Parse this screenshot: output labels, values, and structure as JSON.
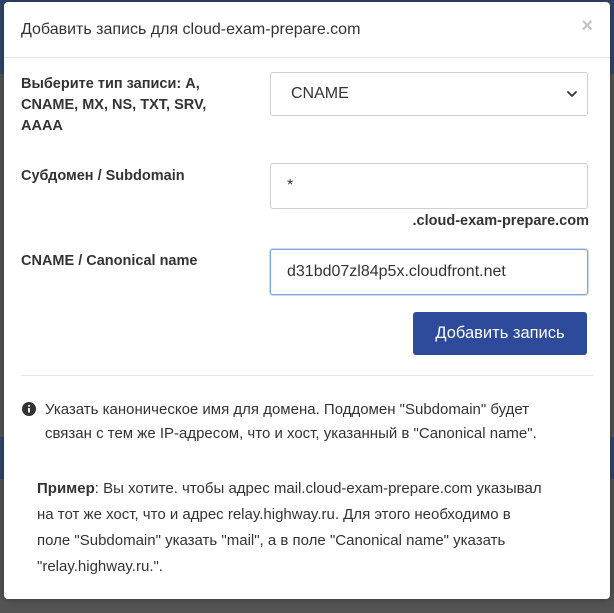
{
  "modal": {
    "title": "Добавить запись для cloud-exam-prepare.com",
    "close_label": "×"
  },
  "form": {
    "record_type": {
      "label_line1": "Выберите тип записи: A,",
      "label_line2": "CNAME, MX, NS, TXT, SRV,",
      "label_line3": "AAAA",
      "selected": "CNAME"
    },
    "subdomain": {
      "label": "Субдомен / Subdomain",
      "value": "*",
      "suffix": ".cloud-exam-prepare.com"
    },
    "cname": {
      "label": "CNAME / Canonical name",
      "value": "d31bd07zl84p5x.cloudfront.net"
    },
    "submit_label": "Добавить запись"
  },
  "help": {
    "info_line1": "Указать каноническое имя для домена. Поддомен \"Subdomain\" будет",
    "info_line2": "связан с тем же IP-адресом, что и хост, указанный в \"Canonical name\".",
    "example_bold": "Пример",
    "example_line1": ": Вы хотите. чтобы адрес mail.cloud-exam-prepare.com указывал",
    "example_line2": "на тот же хост, что и адрес relay.highway.ru. Для этого необходимо в",
    "example_line3": "поле \"Subdomain\" указать \"mail\", а в поле \"Canonical name\" указать",
    "example_line4": "\"relay.highway.ru.\"."
  },
  "colors": {
    "primary": "#2d4b9a",
    "backdrop_nav": "#31466e"
  }
}
